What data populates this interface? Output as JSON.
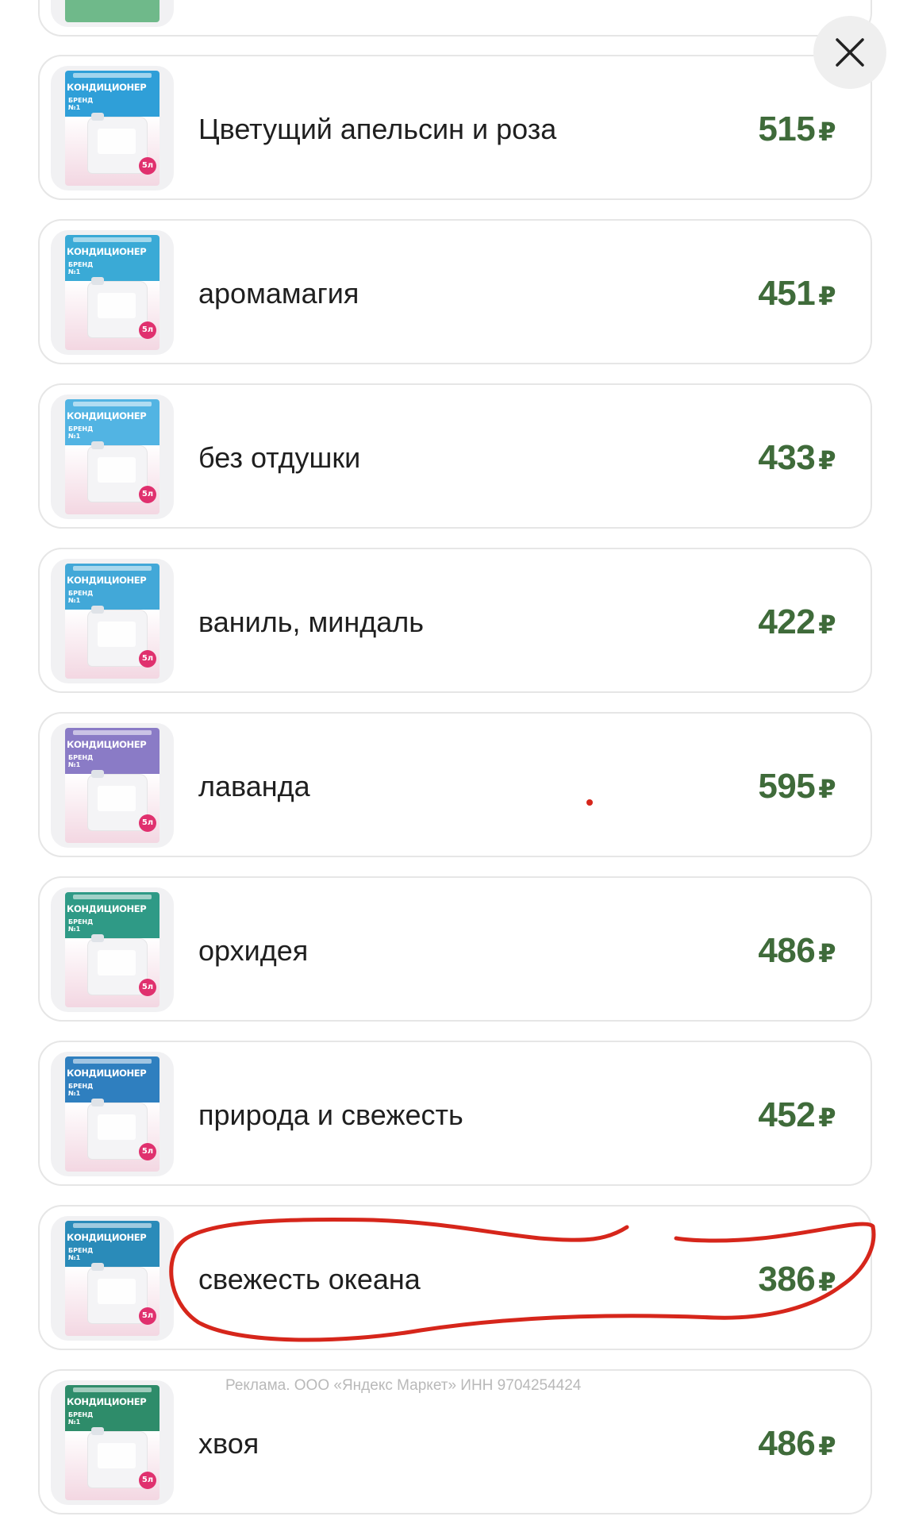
{
  "ad_disclaimer": "Реклама. ООО «Яндекс Маркет» ИНН 9704254424",
  "close_icon": "close-icon",
  "currency": "₽",
  "accent_color": "#3f6b3a",
  "highlight_color": "#d6261b",
  "highlighted_item": "свежесть океана",
  "package_label": "КОНДИЦИОНЕР",
  "package_volume": "5л",
  "items": [
    {
      "name": "",
      "price": "",
      "pack_color": "#6fb98a"
    },
    {
      "name": "Цветущий апельсин и роза",
      "price": "515",
      "pack_color": "#2f9fd8"
    },
    {
      "name": "аромамагия",
      "price": "451",
      "pack_color": "#3aaad6"
    },
    {
      "name": "без отдушки",
      "price": "433",
      "pack_color": "#52b4e3"
    },
    {
      "name": "ваниль, миндаль",
      "price": "422",
      "pack_color": "#42a8d8"
    },
    {
      "name": "лаванда",
      "price": "595",
      "pack_color": "#8a7bc6"
    },
    {
      "name": "орхидея",
      "price": "486",
      "pack_color": "#2f9a86"
    },
    {
      "name": "природа и свежесть",
      "price": "452",
      "pack_color": "#2f7fbf"
    },
    {
      "name": "свежесть океана",
      "price": "386",
      "pack_color": "#2a8bb9"
    },
    {
      "name": "хвоя",
      "price": "486",
      "pack_color": "#2e8c6a"
    }
  ]
}
